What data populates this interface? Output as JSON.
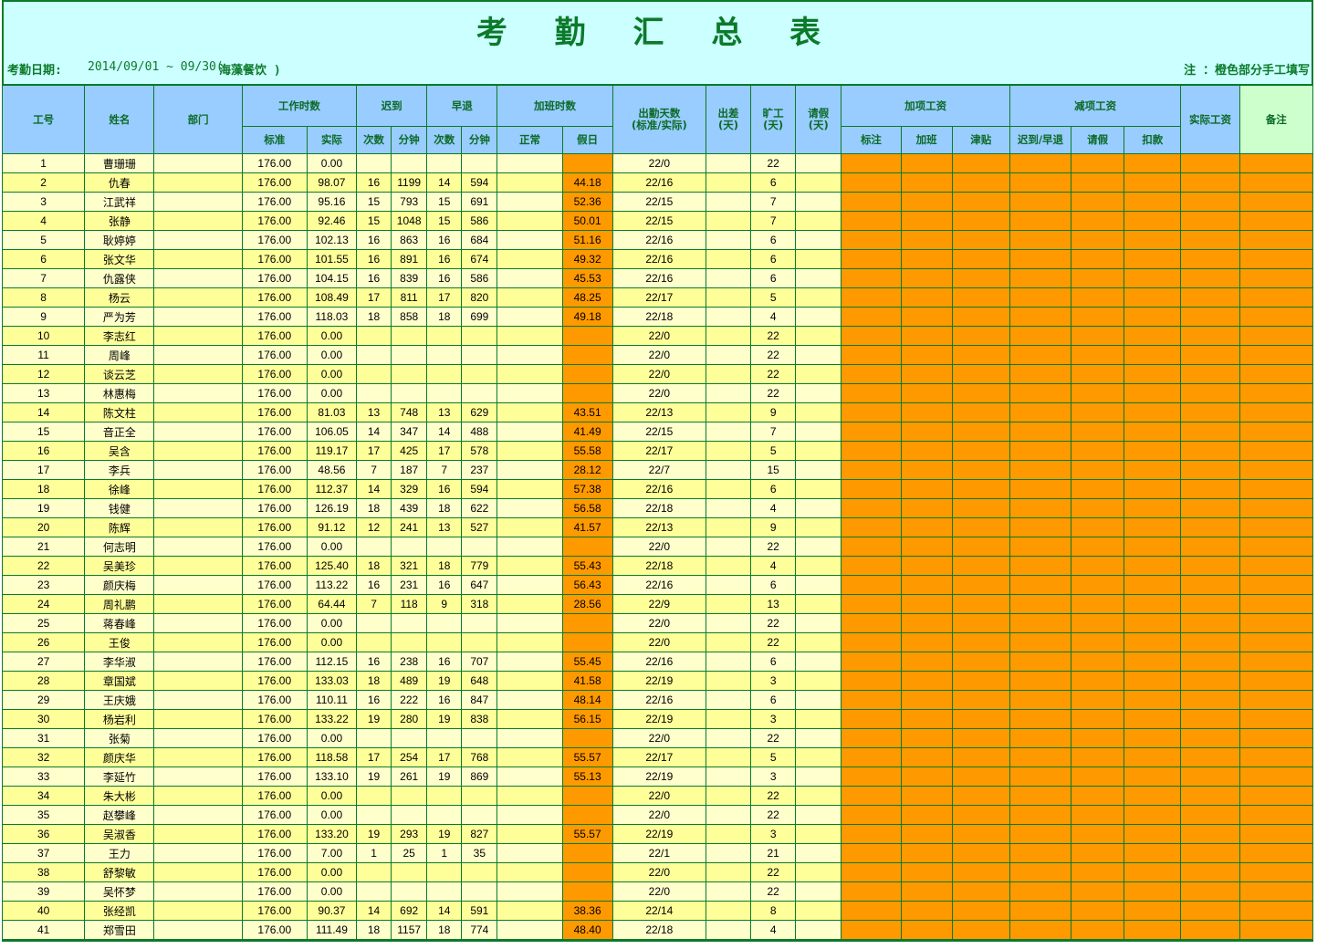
{
  "title": "考 勤 汇 总 表",
  "info": {
    "date_label": "考勤日期:",
    "date_range": "2014/09/01 ~ 09/30(",
    "company": "海藻餐饮 )",
    "note": "注 ：橙色部分手工填写"
  },
  "headers": {
    "emp_id": "工号",
    "name": "姓名",
    "dept": "部门",
    "work_hours": "工作时数",
    "late": "迟到",
    "early": "早退",
    "overtime": "加班时数",
    "attendance_days": "出勤天数\n(标准/实际)",
    "business_trip": "出差\n(天)",
    "absent": "旷工\n(天)",
    "leave": "请假\n(天)",
    "add_pay": "加项工资",
    "deduct_pay": "减项工资",
    "actual_pay": "实际工资",
    "remarks": "备注",
    "sub": {
      "std": "标准",
      "actual": "实际",
      "late_count": "次数",
      "late_min": "分钟",
      "early_count": "次数",
      "early_min": "分钟",
      "normal": "正常",
      "holiday": "假日",
      "base": "标注",
      "ot": "加班",
      "allowance": "津贴",
      "late_early": "迟到/早退",
      "leave_deduct": "请假",
      "fine": "扣款"
    }
  },
  "rows": [
    {
      "id": "1",
      "name": "曹珊珊",
      "std": "176.00",
      "act": "0.00",
      "lc": "",
      "lm": "",
      "ec": "",
      "em": "",
      "hol": "",
      "days": "22/0",
      "absent": "22"
    },
    {
      "id": "2",
      "name": "仇春",
      "std": "176.00",
      "act": "98.07",
      "lc": "16",
      "lm": "1199",
      "ec": "14",
      "em": "594",
      "hol": "44.18",
      "days": "22/16",
      "absent": "6"
    },
    {
      "id": "3",
      "name": "江武祥",
      "std": "176.00",
      "act": "95.16",
      "lc": "15",
      "lm": "793",
      "ec": "15",
      "em": "691",
      "hol": "52.36",
      "days": "22/15",
      "absent": "7"
    },
    {
      "id": "4",
      "name": "张静",
      "std": "176.00",
      "act": "92.46",
      "lc": "15",
      "lm": "1048",
      "ec": "15",
      "em": "586",
      "hol": "50.01",
      "days": "22/15",
      "absent": "7"
    },
    {
      "id": "5",
      "name": "耿婷婷",
      "std": "176.00",
      "act": "102.13",
      "lc": "16",
      "lm": "863",
      "ec": "16",
      "em": "684",
      "hol": "51.16",
      "days": "22/16",
      "absent": "6"
    },
    {
      "id": "6",
      "name": "张文华",
      "std": "176.00",
      "act": "101.55",
      "lc": "16",
      "lm": "891",
      "ec": "16",
      "em": "674",
      "hol": "49.32",
      "days": "22/16",
      "absent": "6"
    },
    {
      "id": "7",
      "name": "仇露侠",
      "std": "176.00",
      "act": "104.15",
      "lc": "16",
      "lm": "839",
      "ec": "16",
      "em": "586",
      "hol": "45.53",
      "days": "22/16",
      "absent": "6"
    },
    {
      "id": "8",
      "name": "杨云",
      "std": "176.00",
      "act": "108.49",
      "lc": "17",
      "lm": "811",
      "ec": "17",
      "em": "820",
      "hol": "48.25",
      "days": "22/17",
      "absent": "5"
    },
    {
      "id": "9",
      "name": "严为芳",
      "std": "176.00",
      "act": "118.03",
      "lc": "18",
      "lm": "858",
      "ec": "18",
      "em": "699",
      "hol": "49.18",
      "days": "22/18",
      "absent": "4"
    },
    {
      "id": "10",
      "name": "李志红",
      "std": "176.00",
      "act": "0.00",
      "lc": "",
      "lm": "",
      "ec": "",
      "em": "",
      "hol": "",
      "days": "22/0",
      "absent": "22"
    },
    {
      "id": "11",
      "name": "周峰",
      "std": "176.00",
      "act": "0.00",
      "lc": "",
      "lm": "",
      "ec": "",
      "em": "",
      "hol": "",
      "days": "22/0",
      "absent": "22"
    },
    {
      "id": "12",
      "name": "谈云芝",
      "std": "176.00",
      "act": "0.00",
      "lc": "",
      "lm": "",
      "ec": "",
      "em": "",
      "hol": "",
      "days": "22/0",
      "absent": "22"
    },
    {
      "id": "13",
      "name": "林惠梅",
      "std": "176.00",
      "act": "0.00",
      "lc": "",
      "lm": "",
      "ec": "",
      "em": "",
      "hol": "",
      "days": "22/0",
      "absent": "22"
    },
    {
      "id": "14",
      "name": "陈文柱",
      "std": "176.00",
      "act": "81.03",
      "lc": "13",
      "lm": "748",
      "ec": "13",
      "em": "629",
      "hol": "43.51",
      "days": "22/13",
      "absent": "9"
    },
    {
      "id": "15",
      "name": "音正全",
      "std": "176.00",
      "act": "106.05",
      "lc": "14",
      "lm": "347",
      "ec": "14",
      "em": "488",
      "hol": "41.49",
      "days": "22/15",
      "absent": "7"
    },
    {
      "id": "16",
      "name": "吴含",
      "std": "176.00",
      "act": "119.17",
      "lc": "17",
      "lm": "425",
      "ec": "17",
      "em": "578",
      "hol": "55.58",
      "days": "22/17",
      "absent": "5"
    },
    {
      "id": "17",
      "name": "李兵",
      "std": "176.00",
      "act": "48.56",
      "lc": "7",
      "lm": "187",
      "ec": "7",
      "em": "237",
      "hol": "28.12",
      "days": "22/7",
      "absent": "15"
    },
    {
      "id": "18",
      "name": "徐峰",
      "std": "176.00",
      "act": "112.37",
      "lc": "14",
      "lm": "329",
      "ec": "16",
      "em": "594",
      "hol": "57.38",
      "days": "22/16",
      "absent": "6"
    },
    {
      "id": "19",
      "name": "钱健",
      "std": "176.00",
      "act": "126.19",
      "lc": "18",
      "lm": "439",
      "ec": "18",
      "em": "622",
      "hol": "56.58",
      "days": "22/18",
      "absent": "4"
    },
    {
      "id": "20",
      "name": "陈辉",
      "std": "176.00",
      "act": "91.12",
      "lc": "12",
      "lm": "241",
      "ec": "13",
      "em": "527",
      "hol": "41.57",
      "days": "22/13",
      "absent": "9"
    },
    {
      "id": "21",
      "name": "何志明",
      "std": "176.00",
      "act": "0.00",
      "lc": "",
      "lm": "",
      "ec": "",
      "em": "",
      "hol": "",
      "days": "22/0",
      "absent": "22"
    },
    {
      "id": "22",
      "name": "吴美珍",
      "std": "176.00",
      "act": "125.40",
      "lc": "18",
      "lm": "321",
      "ec": "18",
      "em": "779",
      "hol": "55.43",
      "days": "22/18",
      "absent": "4"
    },
    {
      "id": "23",
      "name": "颜庆梅",
      "std": "176.00",
      "act": "113.22",
      "lc": "16",
      "lm": "231",
      "ec": "16",
      "em": "647",
      "hol": "56.43",
      "days": "22/16",
      "absent": "6"
    },
    {
      "id": "24",
      "name": "周礼鹏",
      "std": "176.00",
      "act": "64.44",
      "lc": "7",
      "lm": "118",
      "ec": "9",
      "em": "318",
      "hol": "28.56",
      "days": "22/9",
      "absent": "13"
    },
    {
      "id": "25",
      "name": "蒋春峰",
      "std": "176.00",
      "act": "0.00",
      "lc": "",
      "lm": "",
      "ec": "",
      "em": "",
      "hol": "",
      "days": "22/0",
      "absent": "22"
    },
    {
      "id": "26",
      "name": "王俊",
      "std": "176.00",
      "act": "0.00",
      "lc": "",
      "lm": "",
      "ec": "",
      "em": "",
      "hol": "",
      "days": "22/0",
      "absent": "22"
    },
    {
      "id": "27",
      "name": "李华淑",
      "std": "176.00",
      "act": "112.15",
      "lc": "16",
      "lm": "238",
      "ec": "16",
      "em": "707",
      "hol": "55.45",
      "days": "22/16",
      "absent": "6"
    },
    {
      "id": "28",
      "name": "章国斌",
      "std": "176.00",
      "act": "133.03",
      "lc": "18",
      "lm": "489",
      "ec": "19",
      "em": "648",
      "hol": "41.58",
      "days": "22/19",
      "absent": "3"
    },
    {
      "id": "29",
      "name": "王庆娥",
      "std": "176.00",
      "act": "110.11",
      "lc": "16",
      "lm": "222",
      "ec": "16",
      "em": "847",
      "hol": "48.14",
      "days": "22/16",
      "absent": "6"
    },
    {
      "id": "30",
      "name": "杨岩利",
      "std": "176.00",
      "act": "133.22",
      "lc": "19",
      "lm": "280",
      "ec": "19",
      "em": "838",
      "hol": "56.15",
      "days": "22/19",
      "absent": "3"
    },
    {
      "id": "31",
      "name": "张菊",
      "std": "176.00",
      "act": "0.00",
      "lc": "",
      "lm": "",
      "ec": "",
      "em": "",
      "hol": "",
      "days": "22/0",
      "absent": "22"
    },
    {
      "id": "32",
      "name": "颜庆华",
      "std": "176.00",
      "act": "118.58",
      "lc": "17",
      "lm": "254",
      "ec": "17",
      "em": "768",
      "hol": "55.57",
      "days": "22/17",
      "absent": "5"
    },
    {
      "id": "33",
      "name": "李延竹",
      "std": "176.00",
      "act": "133.10",
      "lc": "19",
      "lm": "261",
      "ec": "19",
      "em": "869",
      "hol": "55.13",
      "days": "22/19",
      "absent": "3"
    },
    {
      "id": "34",
      "name": "朱大彬",
      "std": "176.00",
      "act": "0.00",
      "lc": "",
      "lm": "",
      "ec": "",
      "em": "",
      "hol": "",
      "days": "22/0",
      "absent": "22"
    },
    {
      "id": "35",
      "name": "赵攀峰",
      "std": "176.00",
      "act": "0.00",
      "lc": "",
      "lm": "",
      "ec": "",
      "em": "",
      "hol": "",
      "days": "22/0",
      "absent": "22"
    },
    {
      "id": "36",
      "name": "吴淑香",
      "std": "176.00",
      "act": "133.20",
      "lc": "19",
      "lm": "293",
      "ec": "19",
      "em": "827",
      "hol": "55.57",
      "days": "22/19",
      "absent": "3"
    },
    {
      "id": "37",
      "name": "王力",
      "std": "176.00",
      "act": "7.00",
      "lc": "1",
      "lm": "25",
      "ec": "1",
      "em": "35",
      "hol": "",
      "days": "22/1",
      "absent": "21"
    },
    {
      "id": "38",
      "name": "舒黎敏",
      "std": "176.00",
      "act": "0.00",
      "lc": "",
      "lm": "",
      "ec": "",
      "em": "",
      "hol": "",
      "days": "22/0",
      "absent": "22"
    },
    {
      "id": "39",
      "name": "吴怀梦",
      "std": "176.00",
      "act": "0.00",
      "lc": "",
      "lm": "",
      "ec": "",
      "em": "",
      "hol": "",
      "days": "22/0",
      "absent": "22"
    },
    {
      "id": "40",
      "name": "张经凯",
      "std": "176.00",
      "act": "90.37",
      "lc": "14",
      "lm": "692",
      "ec": "14",
      "em": "591",
      "hol": "38.36",
      "days": "22/14",
      "absent": "8"
    },
    {
      "id": "41",
      "name": "郑雪田",
      "std": "176.00",
      "act": "111.49",
      "lc": "18",
      "lm": "1157",
      "ec": "18",
      "em": "774",
      "hol": "48.40",
      "days": "22/18",
      "absent": "4"
    }
  ],
  "colors": {
    "header_blue": "#99ccff",
    "title_bg": "#ccffff",
    "row_light": "#ffffcc",
    "row_yellow": "#ffff99",
    "manual_orange": "#ff9900",
    "border_green": "#0b7a2a"
  }
}
